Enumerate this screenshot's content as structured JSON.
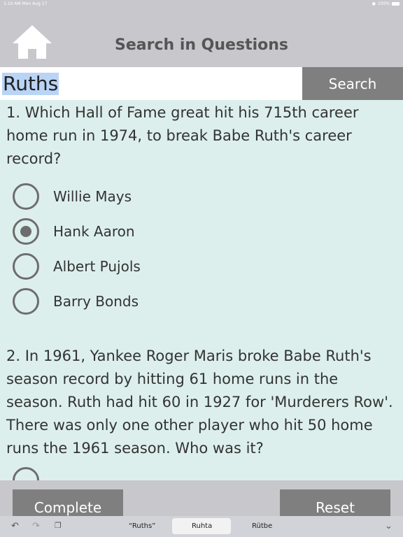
{
  "status_bar": {
    "time_date": "1:10 AM   Mon Aug 17",
    "battery": "100%"
  },
  "header": {
    "title": "Search in Questions",
    "home_icon": "home-icon"
  },
  "search": {
    "value": "Ruths",
    "button_label": "Search"
  },
  "questions": [
    {
      "text": "1. Which Hall of Fame great hit his 715th career home run in 1974, to break Babe Ruth's career record?",
      "options": [
        {
          "label": "Willie Mays",
          "selected": false
        },
        {
          "label": "Hank Aaron",
          "selected": true
        },
        {
          "label": "Albert Pujols",
          "selected": false
        },
        {
          "label": "Barry Bonds",
          "selected": false
        }
      ]
    },
    {
      "text": "2. In 1961, Yankee Roger Maris broke Babe Ruth's season record by hitting 61 home runs in the season. Ruth had hit 60 in 1927 for 'Murderers Row'. There was only one other player who hit 50 home runs the 1961 season. Who was it?"
    }
  ],
  "footer": {
    "complete_label": "Complete",
    "reset_label": "Reset"
  },
  "keyboard_bar": {
    "suggestions": [
      "“Ruths”",
      "Ruhta",
      "Rütbe"
    ],
    "icons": [
      "undo-icon",
      "redo-icon",
      "clipboard-icon",
      "chevron-down-icon"
    ]
  }
}
